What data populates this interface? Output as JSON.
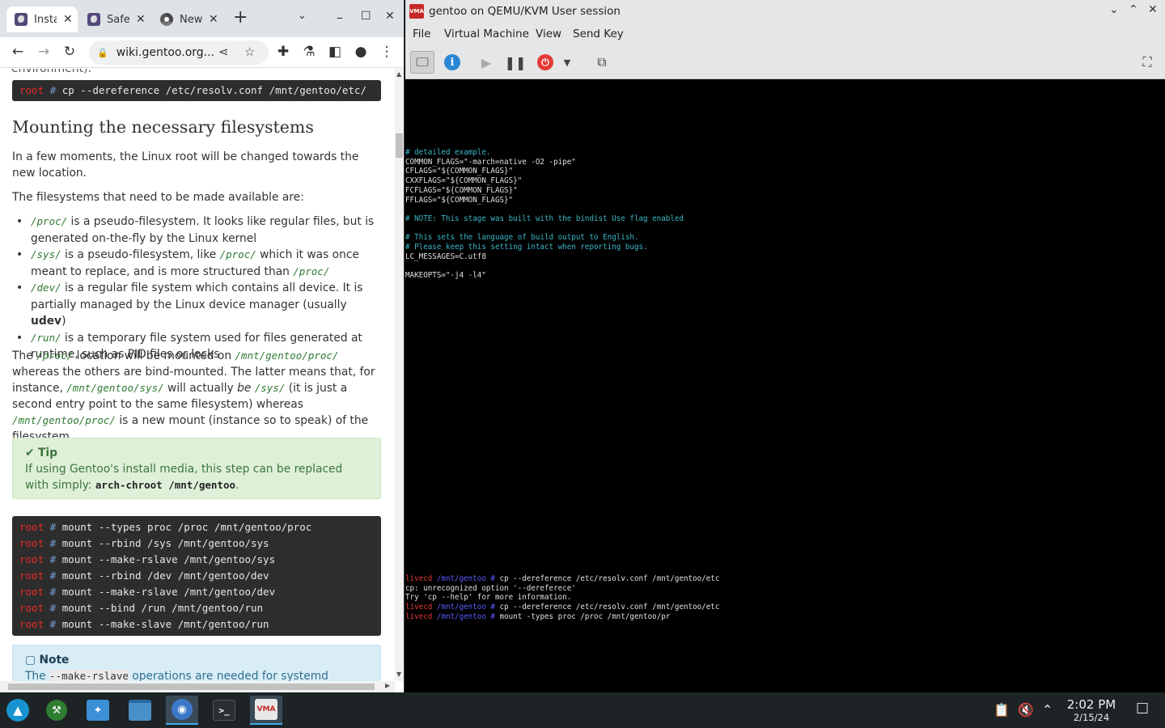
{
  "browser": {
    "tabs": [
      {
        "label": "Insta"
      },
      {
        "label": "Safe"
      },
      {
        "label": "New"
      }
    ],
    "url": "wiki.gentoo.org...",
    "page": {
      "cut_text": "environment).",
      "code1": {
        "prompt": "root",
        "hash": "#",
        "cmd": "cp --dereference /etc/resolv.conf /mnt/gentoo/etc/"
      },
      "heading": "Mounting the necessary filesystems",
      "p1": "In a few moments, the Linux root will be changed towards the new location.",
      "p2": "The filesystems that need to be made available are:",
      "list": [
        {
          "code": "/proc/",
          "text": " is a pseudo-filesystem. It looks like regular files, but is generated on-the-fly by the Linux kernel"
        },
        {
          "code": "/sys/",
          "text1": " is a pseudo-filesystem, like ",
          "code2": "/proc/",
          "text2": " which it was once meant to replace, and is more structured than ",
          "code3": "/proc/"
        },
        {
          "code": "/dev/",
          "text1": " is a regular file system which contains all device. It is partially managed by the Linux device manager (usually ",
          "bold": "udev",
          "text2": ")"
        },
        {
          "code": "/run/",
          "text": " is a temporary file system used for files generated at runtime, such as PID files or locks"
        }
      ],
      "p3": {
        "a": "The ",
        "c1": "/proc/",
        "b": " location will be mounted on ",
        "c2": "/mnt/gentoo/proc/",
        "c": " whereas the others are bind-mounted. The latter means that, for instance, ",
        "c3": "/mnt/gentoo/sys/",
        "d": " will actually ",
        "em": "be",
        "e": " ",
        "c4": "/sys/",
        "f": " (it is just a second entry point to the same filesystem) whereas ",
        "c5": "/mnt/gentoo/proc/",
        "g": " is a new mount (instance so to speak) of the filesystem."
      },
      "tip": {
        "heading": "Tip",
        "text": "If using Gentoo's install media, this step can be replaced with simply: ",
        "code": "arch-chroot /mnt/gentoo",
        "end": "."
      },
      "code2": [
        "mount --types proc /proc /mnt/gentoo/proc",
        "mount --rbind /sys /mnt/gentoo/sys",
        "mount --make-rslave /mnt/gentoo/sys",
        "mount --rbind /dev /mnt/gentoo/dev",
        "mount --make-rslave /mnt/gentoo/dev",
        "mount --bind /run /mnt/gentoo/run",
        "mount --make-slave /mnt/gentoo/run"
      ],
      "note": {
        "heading": "Note",
        "a": "The ",
        "code": "--make-rslave",
        "b": " operations are needed for systemd"
      }
    }
  },
  "vm": {
    "title": "gentoo on QEMU/KVM User session",
    "app_icon_text": "VMA",
    "menu": [
      "File",
      "Virtual Machine",
      "View",
      "Send Key"
    ],
    "console_top": [
      {
        "t": "# detailed example.",
        "c": "cm"
      },
      {
        "t": "COMMON_FLAGS=\"-march=native -O2 -pipe\"",
        "c": ""
      },
      {
        "t": "CFLAGS=\"${COMMON_FLAGS}\"",
        "c": ""
      },
      {
        "t": "CXXFLAGS=\"${COMMON_FLAGS}\"",
        "c": ""
      },
      {
        "t": "FCFLAGS=\"${COMMON_FLAGS}\"",
        "c": ""
      },
      {
        "t": "FFLAGS=\"${COMMON_FLAGS}\"",
        "c": ""
      },
      {
        "t": "",
        "c": ""
      },
      {
        "t": "# NOTE: This stage was built with the bindist Use flag enabled",
        "c": "cm"
      },
      {
        "t": "",
        "c": ""
      },
      {
        "t": "# This sets the language of build output to English.",
        "c": "cm"
      },
      {
        "t": "# Please keep this setting intact when reporting bugs.",
        "c": "cm"
      },
      {
        "t": "LC_MESSAGES=C.utf8",
        "c": ""
      },
      {
        "t": "",
        "c": ""
      },
      {
        "t": "MAKEOPTS=\"-j4 -l4\"",
        "c": ""
      }
    ],
    "console_bottom": [
      {
        "prompt": "livecd",
        "path": "/mnt/gentoo #",
        "cmd": " cp --dereference /etc/resolv.conf /mnt/gentoo/etc"
      },
      {
        "plain": "cp: unrecognized option '--dereferece'"
      },
      {
        "plain": "Try 'cp --help' for more information."
      },
      {
        "prompt": "livecd",
        "path": "/mnt/gentoo #",
        "cmd": " cp --dereference /etc/resolv.conf /mnt/gentoo/etc"
      },
      {
        "prompt": "livecd",
        "path": "/mnt/gentoo #",
        "cmd": " mount -types proc /proc /mnt/gentoo/pr"
      }
    ]
  },
  "taskbar": {
    "time": "2:02 PM",
    "date": "2/15/24",
    "vm_icon_text": "VMA"
  }
}
